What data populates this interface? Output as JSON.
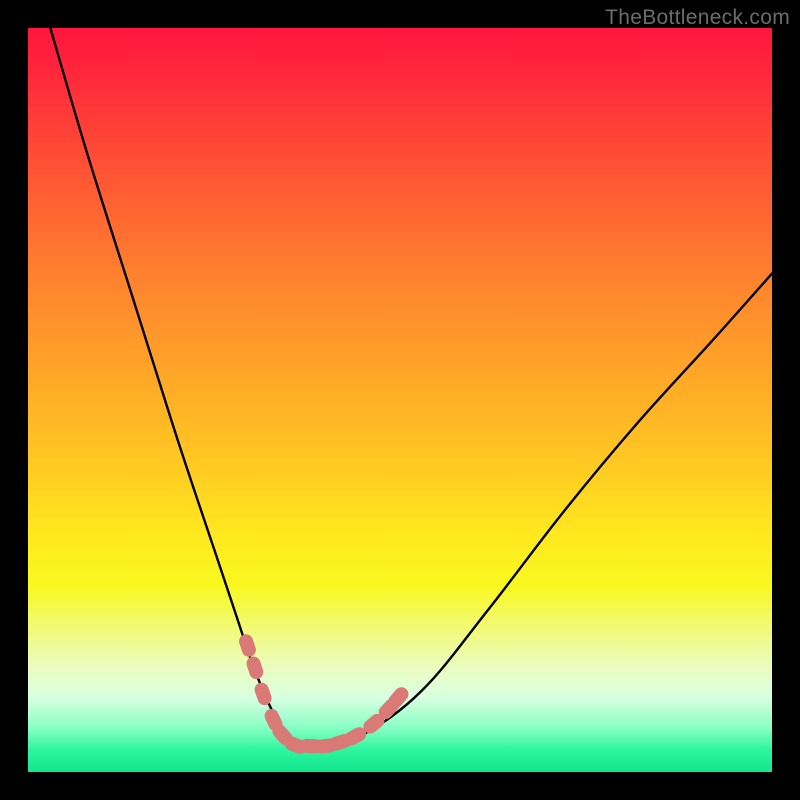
{
  "watermark": "TheBottleneck.com",
  "colors": {
    "curve": "#000000",
    "highlight_fill": "#d97a76",
    "highlight_stroke": "#d97a76",
    "gradient_top": "#ff153d",
    "gradient_bottom": "#12e58f",
    "frame": "#000000"
  },
  "chart_data": {
    "type": "line",
    "title": "",
    "xlabel": "",
    "ylabel": "",
    "xlim": [
      0,
      100
    ],
    "ylim": [
      0,
      100
    ],
    "note": "Axes are unlabeled in the source image; x/y values are normalized 0–100 estimates read off pixel positions.",
    "series": [
      {
        "name": "bottleneck-curve",
        "x": [
          3,
          8,
          14,
          20,
          25,
          28,
          30,
          32,
          34,
          35.5,
          37,
          40,
          45,
          53,
          62,
          72,
          82,
          92,
          100
        ],
        "y": [
          100,
          83,
          64,
          45,
          30,
          21,
          15,
          10,
          6,
          4,
          3.5,
          3.5,
          5,
          11,
          22,
          35,
          47,
          58,
          67
        ]
      }
    ],
    "highlight_points": {
      "name": "markers",
      "points": [
        {
          "x": 29.5,
          "y": 17
        },
        {
          "x": 30.5,
          "y": 14
        },
        {
          "x": 31.6,
          "y": 10.5
        },
        {
          "x": 33.0,
          "y": 7
        },
        {
          "x": 34.2,
          "y": 5
        },
        {
          "x": 36.0,
          "y": 3.6
        },
        {
          "x": 38.0,
          "y": 3.5
        },
        {
          "x": 40.0,
          "y": 3.5
        },
        {
          "x": 42.0,
          "y": 4
        },
        {
          "x": 44.0,
          "y": 4.8
        },
        {
          "x": 46.5,
          "y": 6.5
        },
        {
          "x": 48.5,
          "y": 8.5
        },
        {
          "x": 49.8,
          "y": 10
        }
      ]
    }
  }
}
